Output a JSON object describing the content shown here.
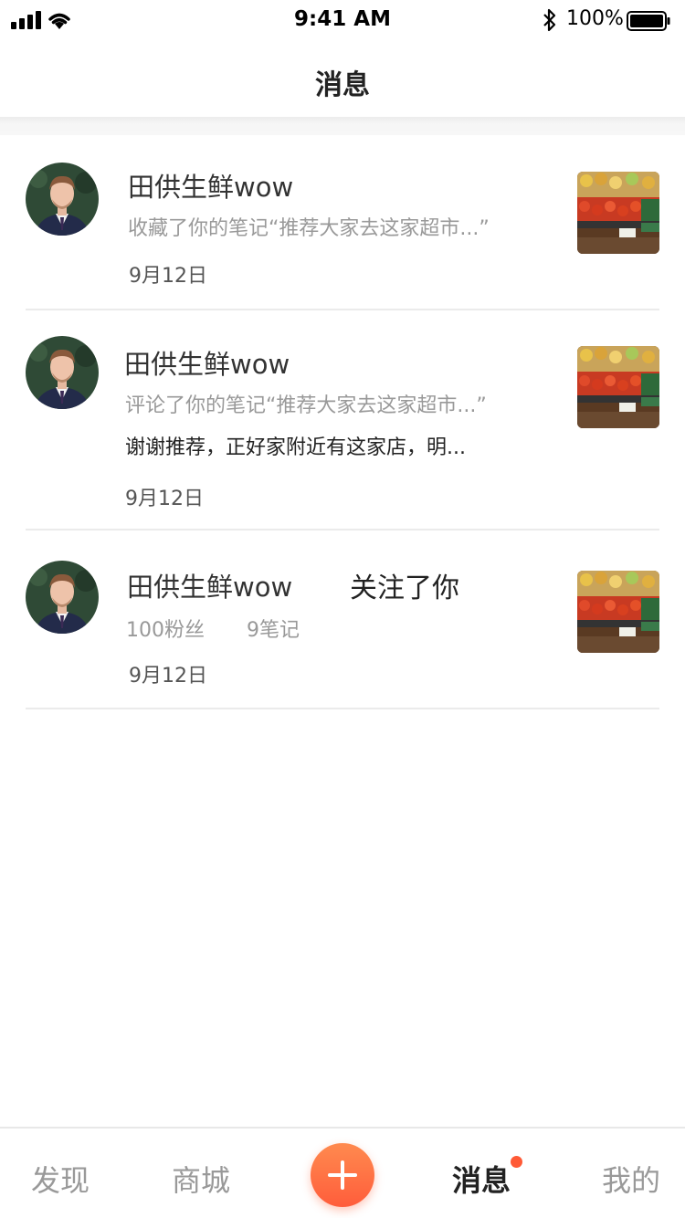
{
  "status_bar": {
    "time": "9:41 AM",
    "battery": "100%"
  },
  "nav": {
    "title": "消息"
  },
  "messages": [
    {
      "name": "田供生鲜wow",
      "action": "收藏了你的笔记“推荐大家去这家超市...”",
      "date": "9月12日"
    },
    {
      "name": "田供生鲜wow",
      "action": "评论了你的笔记“推荐大家去这家超市...”",
      "comment": "谢谢推荐，正好家附近有这家店，明...",
      "date": "9月12日"
    },
    {
      "name": "田供生鲜wow",
      "follow_text": "关注了你",
      "fans": "100粉丝",
      "notes": "9笔记",
      "date": "9月12日"
    }
  ],
  "tabs": [
    {
      "label": "发现"
    },
    {
      "label": "商城"
    },
    {
      "label": "消息"
    },
    {
      "label": "我的"
    }
  ],
  "colors": {
    "accent": "#ff5d3b",
    "badge": "#ff5a36"
  }
}
